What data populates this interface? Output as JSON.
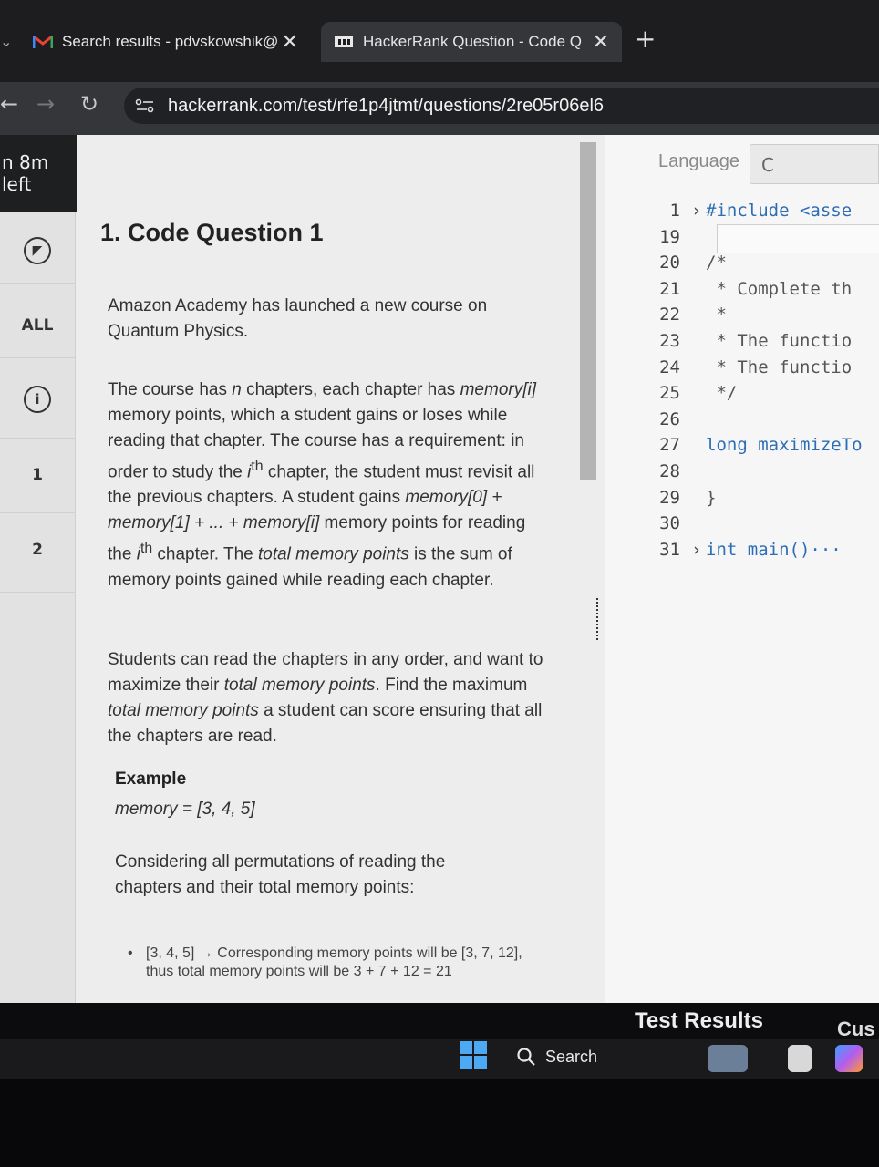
{
  "browser": {
    "tabs": [
      {
        "label": "Search results - pdvskowshik@",
        "active": false
      },
      {
        "label": "HackerRank Question - Code Q",
        "active": true
      }
    ],
    "new_tab": "+",
    "url": "hackerrank.com/test/rfe1p4jtmt/questions/2re05r06el6"
  },
  "timer": "n 8m left",
  "nav": {
    "all_label": "ALL",
    "q1": "1",
    "q2": "2"
  },
  "question": {
    "title": "1. Code Question 1",
    "intro": "Amazon Academy has launched a new course on Quantum Physics.",
    "body_a": "The course has ",
    "body_n": "n",
    "body_b": " chapters, each chapter has ",
    "body_mem_i": "memory[i]",
    "body_c": " memory points, which a student gains or loses while reading that chapter. The course has a requirement: in order to study the ",
    "body_ith": "i",
    "body_th": "th",
    "body_d": " chapter, the student must revisit all the previous chapters. A student gains ",
    "body_sum": "memory[0] + memory[1] + ... + memory[i]",
    "body_e": " memory points for reading the ",
    "body_ith2": "i",
    "body_th2": "th",
    "body_f": " chapter. The ",
    "body_tmp": "total memory points",
    "body_g": " is the sum of memory points gained while reading each chapter.",
    "goal_a": "Students can read the chapters in any order, and want to maximize their ",
    "goal_tmp": "total memory points",
    "goal_b": ". Find the maximum ",
    "goal_tmp2": "total memory points",
    "goal_c": " a student can score ensuring that all the chapters are read.",
    "example_heading": "Example",
    "example_memory": "memory = [3, 4, 5]",
    "permutations_text": "Considering all permutations of reading the chapters and their total memory points:",
    "bullet_1": "[3, 4, 5] → Corresponding memory points will be [3, 7, 12], thus total memory points will be 3 + 7 + 12 = 21"
  },
  "editor": {
    "language_label": "Language",
    "language_value": "C",
    "lines": [
      {
        "n": "1",
        "text": "#include <asse",
        "fold": true
      },
      {
        "n": "19",
        "text": ""
      },
      {
        "n": "20",
        "text": "/*"
      },
      {
        "n": "21",
        "text": " * Complete th"
      },
      {
        "n": "22",
        "text": " *"
      },
      {
        "n": "23",
        "text": " * The functio"
      },
      {
        "n": "24",
        "text": " * The functio"
      },
      {
        "n": "25",
        "text": " */"
      },
      {
        "n": "26",
        "text": ""
      },
      {
        "n": "27",
        "text": "long maximizeTo"
      },
      {
        "n": "28",
        "text": ""
      },
      {
        "n": "29",
        "text": "}"
      },
      {
        "n": "30",
        "text": ""
      },
      {
        "n": "31",
        "text": "int main()···",
        "fold": true
      }
    ]
  },
  "bottom": {
    "test_results": "Test Results",
    "custom": "Cus"
  },
  "taskbar": {
    "search": "Search"
  }
}
